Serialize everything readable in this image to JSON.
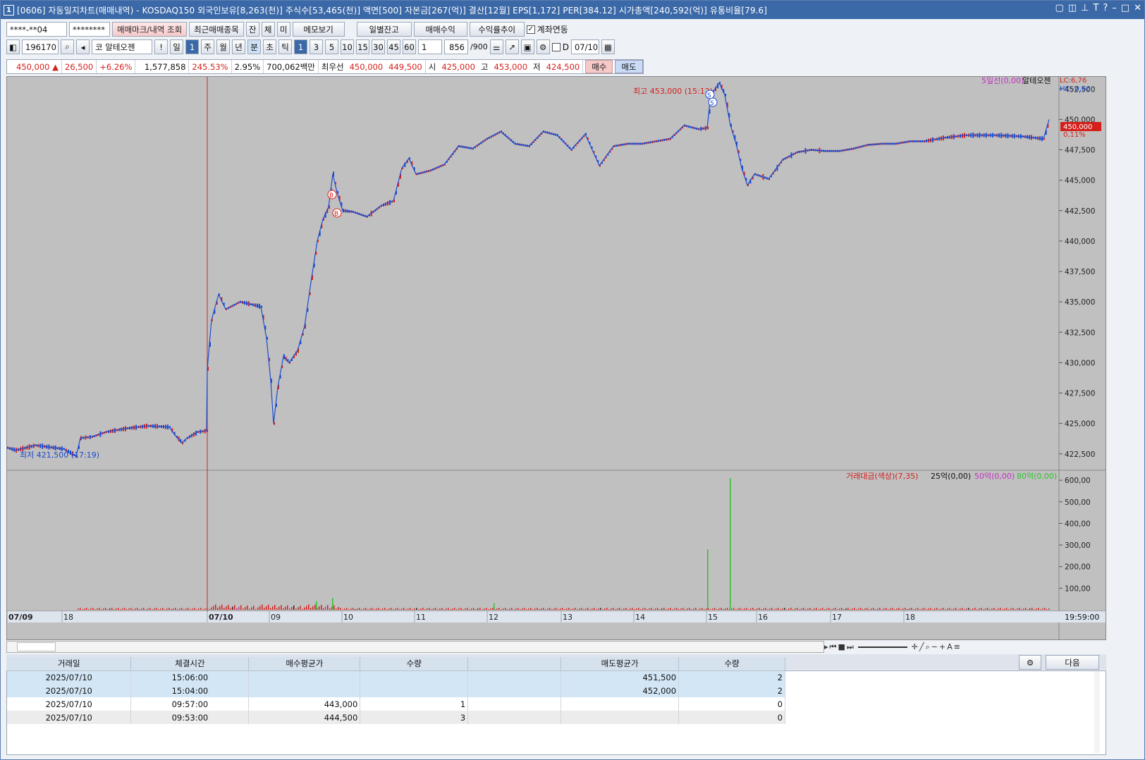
{
  "title": "[0606] 자동일지차트(매매내역) - KOSDAQ150 외국인보유[8,263(천)] 주식수[53,465(천)] 액면[500] 자본금[267(억)] 결산[12월] EPS[1,172] PER[384.12] 시가총액[240,592(억)] 유통비율[79.6]",
  "title_icon": "1",
  "toolbar1": {
    "account": "****-**04",
    "password": "********",
    "btn_view": "매매마크/내역 조회",
    "btn_recent": "최근매매종목",
    "chk1": "잔",
    "chk2": "체",
    "chk3": "미",
    "btn_memo": "메모보기",
    "btn_daily": "일별잔고",
    "btn_profit": "매매수익",
    "btn_rate": "수익률추이",
    "link_label": "계좌연동"
  },
  "toolbar2": {
    "code": "196170",
    "name": "코 알테오젠",
    "p1": "일",
    "p1v": "1",
    "periods": [
      "주",
      "월",
      "년",
      "분",
      "초",
      "틱"
    ],
    "mins": [
      "1",
      "3",
      "5",
      "10",
      "15",
      "30",
      "45",
      "60"
    ],
    "mult": "1",
    "count": "856",
    "count_max": "/900",
    "date_flag": "D",
    "date": "07/10"
  },
  "quote": {
    "price": "450,000 ▲",
    "change": "26,500",
    "pct": "+6.26%",
    "volume": "1,577,858",
    "ratio": "245.53%",
    "turn": "2.95%",
    "amount": "700,062백만",
    "best_label": "최우선",
    "best_ask": "450,000",
    "best_bid": "449,500",
    "open_label": "시",
    "open": "425,000",
    "high_label": "고",
    "high": "453,000",
    "low_label": "저",
    "low": "424,500",
    "buy": "매수",
    "sell": "매도"
  },
  "chart_labels": {
    "ma_legend": "5일선(0,00)",
    "stock_name": "알테오젠",
    "lc": "LC:6,76",
    "hc": "HC:-0,66",
    "high_marker": "최고 453,000 (15:12)",
    "low_marker": "최저 421,500 (17:19)",
    "cur_price": "450,000",
    "cur_pct": "0,11%",
    "vol_legend": "거래대금(색상)(7,35)",
    "vol_25": "25억(0,00)",
    "vol_50": "50억(0,00)",
    "vol_80": "80억(0,00)",
    "time_right": "19:59:00"
  },
  "chart_data": {
    "type": "line",
    "price_axis": [
      "452,500",
      "450,000",
      "447,500",
      "445,000",
      "442,500",
      "440,000",
      "437,500",
      "435,000",
      "432,500",
      "430,000",
      "427,500",
      "425,000",
      "422,500"
    ],
    "vol_axis": [
      "600,00",
      "500,00",
      "400,00",
      "300,00",
      "200,00",
      "100,00"
    ],
    "x_ticks": [
      "07/09",
      "18",
      "07/10",
      "09",
      "10",
      "11",
      "12",
      "13",
      "14",
      "15",
      "16",
      "17",
      "18"
    ],
    "price_ylim": [
      421500,
      453500
    ],
    "vol_ylim": [
      0,
      620
    ],
    "price_series": [
      [
        0,
        423000
      ],
      [
        12,
        422800
      ],
      [
        40,
        423200
      ],
      [
        80,
        422900
      ],
      [
        98,
        422300
      ],
      [
        104,
        423800
      ],
      [
        120,
        423900
      ],
      [
        140,
        424300
      ],
      [
        170,
        424600
      ],
      [
        200,
        424800
      ],
      [
        230,
        424700
      ],
      [
        240,
        423900
      ],
      [
        248,
        423400
      ],
      [
        255,
        423800
      ],
      [
        270,
        424300
      ],
      [
        283,
        424400
      ],
      [
        284,
        429500
      ],
      [
        290,
        433500
      ],
      [
        300,
        435600
      ],
      [
        310,
        434400
      ],
      [
        330,
        435000
      ],
      [
        360,
        434600
      ],
      [
        368,
        432000
      ],
      [
        374,
        428500
      ],
      [
        378,
        425000
      ],
      [
        384,
        428000
      ],
      [
        392,
        430500
      ],
      [
        400,
        430000
      ],
      [
        412,
        431000
      ],
      [
        422,
        433000
      ],
      [
        432,
        437000
      ],
      [
        440,
        440000
      ],
      [
        448,
        441800
      ],
      [
        456,
        442800
      ],
      [
        462,
        445500
      ],
      [
        468,
        444000
      ],
      [
        476,
        442500
      ],
      [
        490,
        442400
      ],
      [
        510,
        442000
      ],
      [
        530,
        442900
      ],
      [
        548,
        443300
      ],
      [
        560,
        446000
      ],
      [
        570,
        446800
      ],
      [
        580,
        445500
      ],
      [
        600,
        445800
      ],
      [
        620,
        446300
      ],
      [
        640,
        447800
      ],
      [
        660,
        447600
      ],
      [
        680,
        448400
      ],
      [
        700,
        449000
      ],
      [
        720,
        448000
      ],
      [
        740,
        447800
      ],
      [
        760,
        449000
      ],
      [
        780,
        448700
      ],
      [
        800,
        447500
      ],
      [
        820,
        448800
      ],
      [
        840,
        446200
      ],
      [
        860,
        447800
      ],
      [
        880,
        448000
      ],
      [
        900,
        448000
      ],
      [
        920,
        448200
      ],
      [
        940,
        448400
      ],
      [
        960,
        449500
      ],
      [
        980,
        449200
      ],
      [
        993,
        449300
      ],
      [
        998,
        452000
      ],
      [
        1004,
        452500
      ],
      [
        1010,
        453000
      ],
      [
        1018,
        452000
      ],
      [
        1026,
        449500
      ],
      [
        1034,
        448000
      ],
      [
        1042,
        446000
      ],
      [
        1050,
        444600
      ],
      [
        1060,
        445500
      ],
      [
        1080,
        445100
      ],
      [
        1100,
        446700
      ],
      [
        1120,
        447300
      ],
      [
        1140,
        447500
      ],
      [
        1160,
        447400
      ],
      [
        1180,
        447400
      ],
      [
        1200,
        447600
      ],
      [
        1220,
        447900
      ],
      [
        1240,
        448000
      ],
      [
        1260,
        448000
      ],
      [
        1280,
        448200
      ],
      [
        1300,
        448200
      ],
      [
        1330,
        448500
      ],
      [
        1360,
        448700
      ],
      [
        1400,
        448700
      ],
      [
        1440,
        448600
      ],
      [
        1470,
        448400
      ],
      [
        1478,
        450000
      ]
    ]
  },
  "trade_table": {
    "headers": [
      "거래일",
      "체결시간",
      "매수평균가",
      "수량",
      "",
      "매도평균가",
      "수량"
    ],
    "rows": [
      [
        "2025/07/10",
        "15:06:00",
        "",
        "",
        "",
        "451,500",
        "2"
      ],
      [
        "2025/07/10",
        "15:04:00",
        "",
        "",
        "",
        "452,000",
        "2"
      ],
      [
        "2025/07/10",
        "09:57:00",
        "443,000",
        "1",
        "",
        "",
        "0"
      ],
      [
        "2025/07/10",
        "09:53:00",
        "444,500",
        "3",
        "",
        "",
        "0"
      ]
    ]
  },
  "lower": {
    "gear": "⚙",
    "next": "다음"
  },
  "colors": {
    "up": "#d3201c",
    "down": "#1b4bd0",
    "bg": "#c0c0c0"
  }
}
